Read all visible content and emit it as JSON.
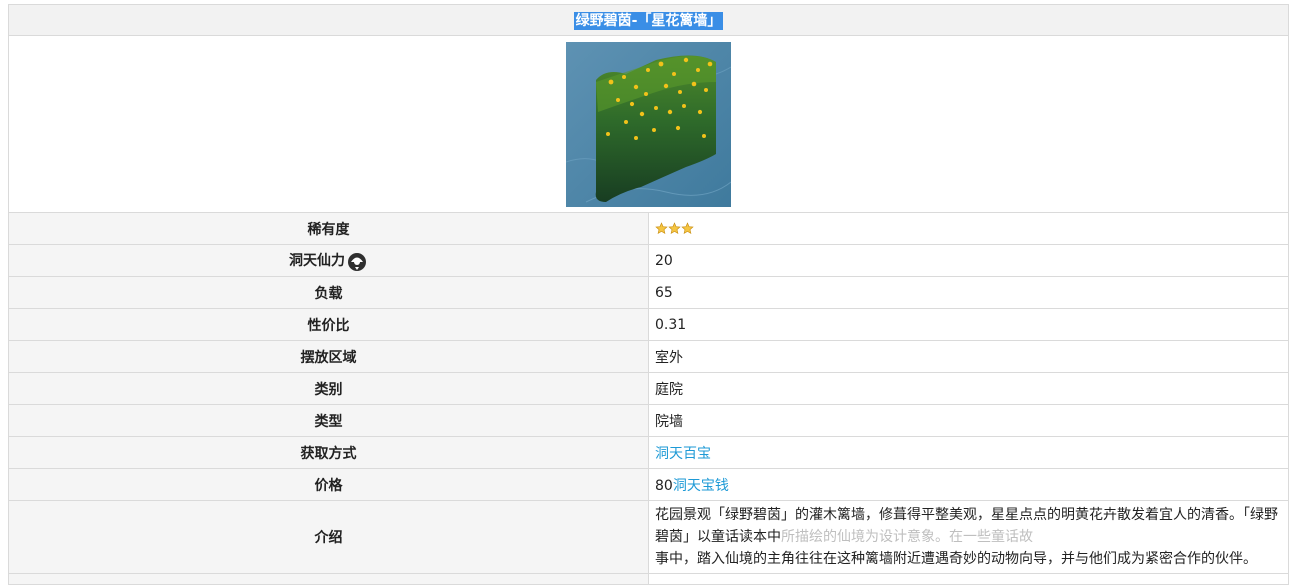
{
  "item": {
    "title": "绿野碧茵-「星花篱墙」",
    "image_alt": "hedge-wall-image"
  },
  "rows": {
    "rarity": {
      "label": "稀有度",
      "star_count": 3
    },
    "adeptal": {
      "label": "洞天仙力",
      "value": "20"
    },
    "load": {
      "label": "负载",
      "value": "65"
    },
    "ratio": {
      "label": "性价比",
      "value": "0.31"
    },
    "area": {
      "label": "摆放区域",
      "value": "室外"
    },
    "category": {
      "label": "类别",
      "value": "庭院"
    },
    "type": {
      "label": "类型",
      "value": "院墙"
    },
    "source": {
      "label": "获取方式",
      "link": "洞天百宝"
    },
    "price": {
      "label": "价格",
      "amount": "80",
      "currency_link": "洞天宝钱"
    },
    "intro": {
      "label": "介绍",
      "text_a": "花园景观「绿野碧茵」的灌木篱墙，修葺得平整美观，星星点点的明黄花卉散发着宜人的清香。「绿野碧茵」以童话读本中",
      "text_b": "所描绘的仙境为设计意象。在一些童话故",
      "text_c": "事中，踏入仙境的主角往往在这种篱墙附近遭遇奇妙的动物向导，并与他们成为紧密合作的伙伴。"
    }
  },
  "colors": {
    "title_highlight": "#3a8ee6",
    "link": "#1e9ad6",
    "label_bg": "#f5f5f5",
    "border": "#dadada"
  }
}
